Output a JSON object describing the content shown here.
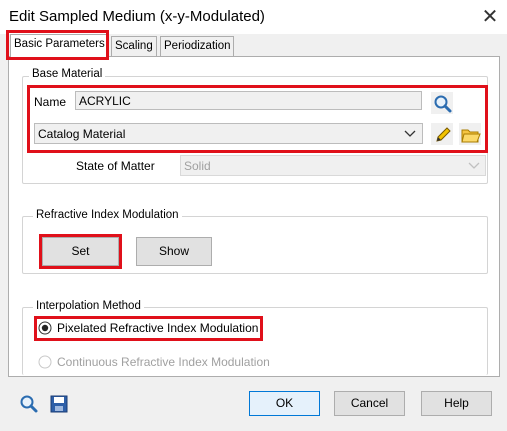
{
  "window": {
    "title": "Edit Sampled Medium (x-y-Modulated)",
    "close_glyph": "✕"
  },
  "tabs": [
    {
      "label": "Basic Parameters",
      "active": true
    },
    {
      "label": "Scaling",
      "active": false
    },
    {
      "label": "Periodization",
      "active": false
    }
  ],
  "base_material": {
    "group_label": "Base Material",
    "name_label": "Name",
    "name_value": "ACRYLIC",
    "catalog_value": "Catalog Material",
    "state_label": "State of Matter",
    "state_value": "Solid"
  },
  "refractive_index": {
    "group_label": "Refractive Index Modulation",
    "set_label": "Set",
    "show_label": "Show"
  },
  "interpolation": {
    "group_label": "Interpolation Method",
    "option1": "Pixelated Refractive Index Modulation",
    "option2": "Continuous Refractive Index Modulation",
    "selected": "Pixelated Refractive Index Modulation"
  },
  "footer": {
    "ok_label": "OK",
    "cancel_label": "Cancel",
    "help_label": "Help"
  },
  "icons": [
    "search-icon",
    "pencil-icon",
    "folder-open-icon",
    "chevron-down-icon",
    "save-icon",
    "close-icon"
  ],
  "colors": {
    "highlight": "#e0101a",
    "accent": "#1a5fb4"
  }
}
